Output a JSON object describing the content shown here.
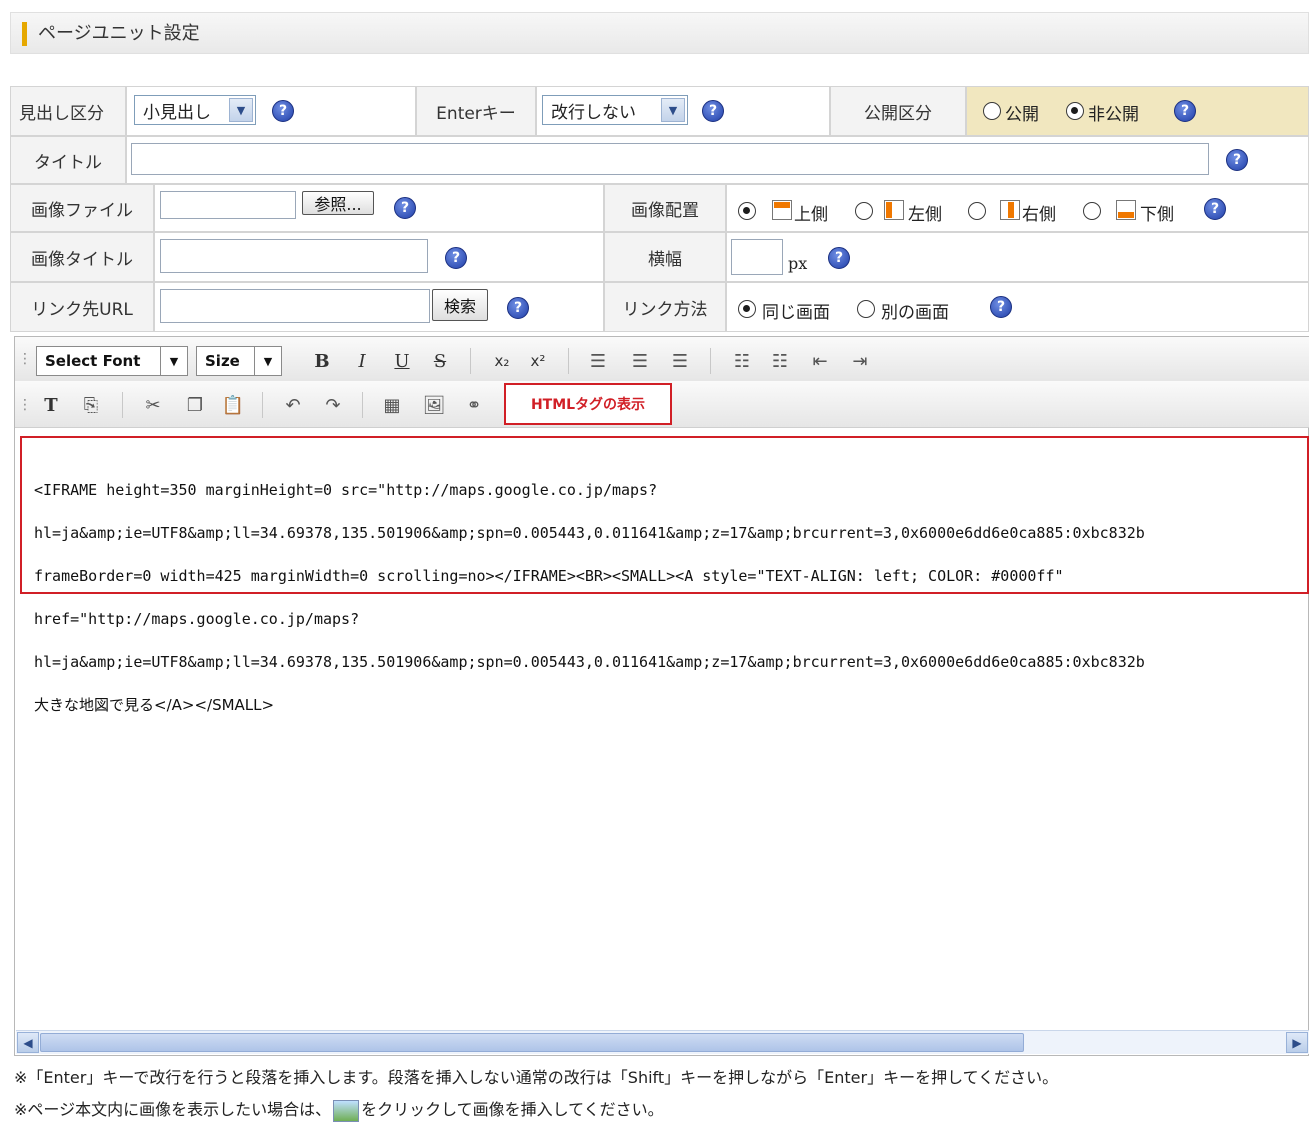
{
  "header": {
    "title": "ページユニット設定"
  },
  "form": {
    "heading_type": {
      "label": "見出し区分",
      "value": "小見出し"
    },
    "enter_key": {
      "label": "Enterキー",
      "value": "改行しない"
    },
    "publish": {
      "label": "公開区分",
      "options": [
        "公開",
        "非公開"
      ],
      "selected": "非公開"
    },
    "title": {
      "label": "タイトル",
      "value": ""
    },
    "image_file": {
      "label": "画像ファイル",
      "browse_label": "参照..."
    },
    "image_position": {
      "label": "画像配置",
      "options": [
        "上側",
        "左側",
        "右側",
        "下側"
      ],
      "selected": "上側"
    },
    "image_title": {
      "label": "画像タイトル",
      "value": ""
    },
    "width": {
      "label": "横幅",
      "value": "",
      "unit": "px"
    },
    "link_url": {
      "label": "リンク先URL",
      "search_label": "検索"
    },
    "link_method": {
      "label": "リンク方法",
      "options": [
        "同じ画面",
        "別の画面"
      ],
      "selected": "同じ画面"
    }
  },
  "toolbar": {
    "font_label": "Select Font",
    "size_label": "Size",
    "bold": "B",
    "italic": "I",
    "underline": "U",
    "strike": "S",
    "html_toggle": "HTMLタグの表示"
  },
  "editor": {
    "code_lines": [
      "<IFRAME height=350 marginHeight=0 src=\"http://maps.google.co.jp/maps?",
      "hl=ja&amp;ie=UTF8&amp;ll=34.69378,135.501906&amp;spn=0.005443,0.011641&amp;z=17&amp;brcurrent=3,0x6000e6dd6e0ca885:0xbc832b",
      "frameBorder=0 width=425 marginWidth=0 scrolling=no></IFRAME><BR><SMALL><A style=\"TEXT-ALIGN: left; COLOR: #0000ff\"",
      "href=\"http://maps.google.co.jp/maps?",
      "hl=ja&amp;ie=UTF8&amp;ll=34.69378,135.501906&amp;spn=0.005443,0.011641&amp;z=17&amp;brcurrent=3,0x6000e6dd6e0ca885:0xbc832b",
      "大きな地図で見る</A></SMALL>"
    ]
  },
  "notes": {
    "line1": "※「Enter」キーで改行を行うと段落を挿入します。段落を挿入しない通常の改行は「Shift」キーを押しながら「Enter」キーを押してください。",
    "line2_pre": "※ページ本文内に画像を表示したい場合は、",
    "line2_post": "をクリックして画像を挿入してください。"
  },
  "colors": {
    "accent_red": "#d11f26",
    "publish_bg": "#f1e7bf",
    "header_bar": "#e6a800"
  },
  "icons": [
    "help-icon",
    "image-insert-icon",
    "scroll-left-icon",
    "scroll-right-icon"
  ]
}
